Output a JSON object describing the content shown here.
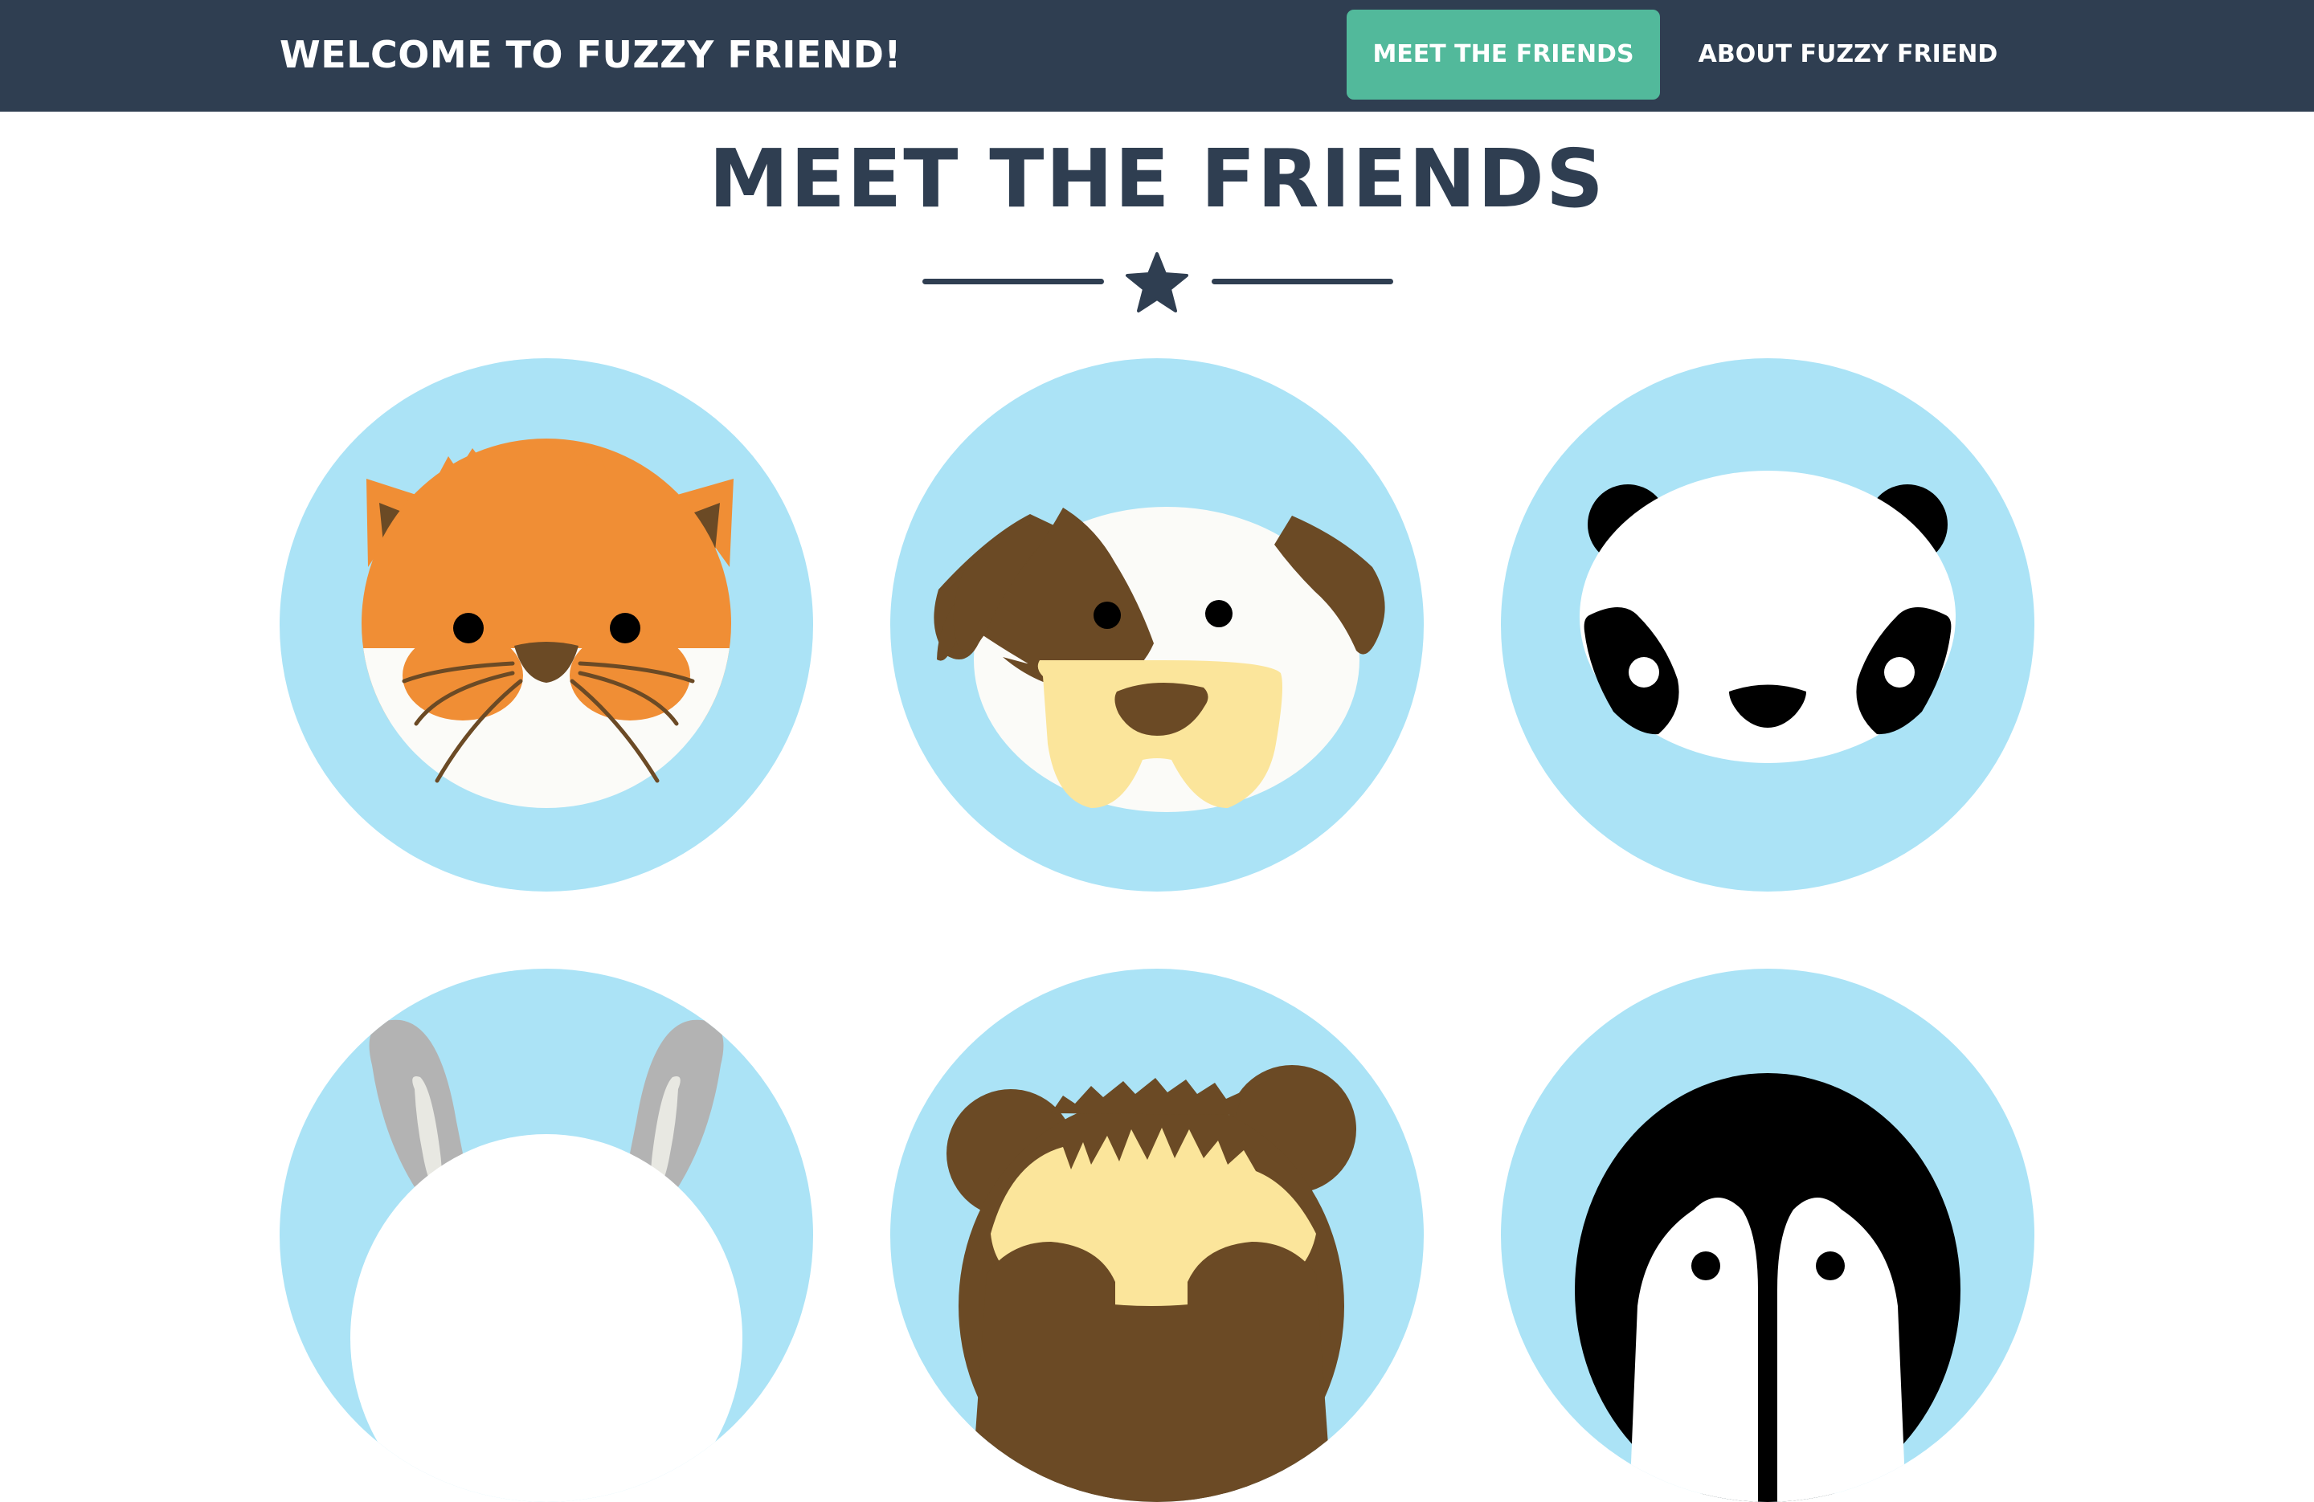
{
  "navbar": {
    "brand": "WELCOME TO FUZZY FRIEND!",
    "links": [
      {
        "label": "MEET THE FRIENDS",
        "active": true
      },
      {
        "label": "ABOUT FUZZY FRIEND",
        "active": false
      }
    ]
  },
  "section": {
    "title": "MEET THE FRIENDS",
    "divider_icon": "star-icon"
  },
  "friends": [
    {
      "icon": "cat-icon"
    },
    {
      "icon": "dog-icon"
    },
    {
      "icon": "panda-icon"
    },
    {
      "icon": "bunny-icon"
    },
    {
      "icon": "bear-icon"
    },
    {
      "icon": "penguin-icon"
    }
  ],
  "colors": {
    "navbar": "#2f3e51",
    "accent": "#52b99b",
    "circle": "#abe3f6",
    "heading": "#2f3e51"
  }
}
